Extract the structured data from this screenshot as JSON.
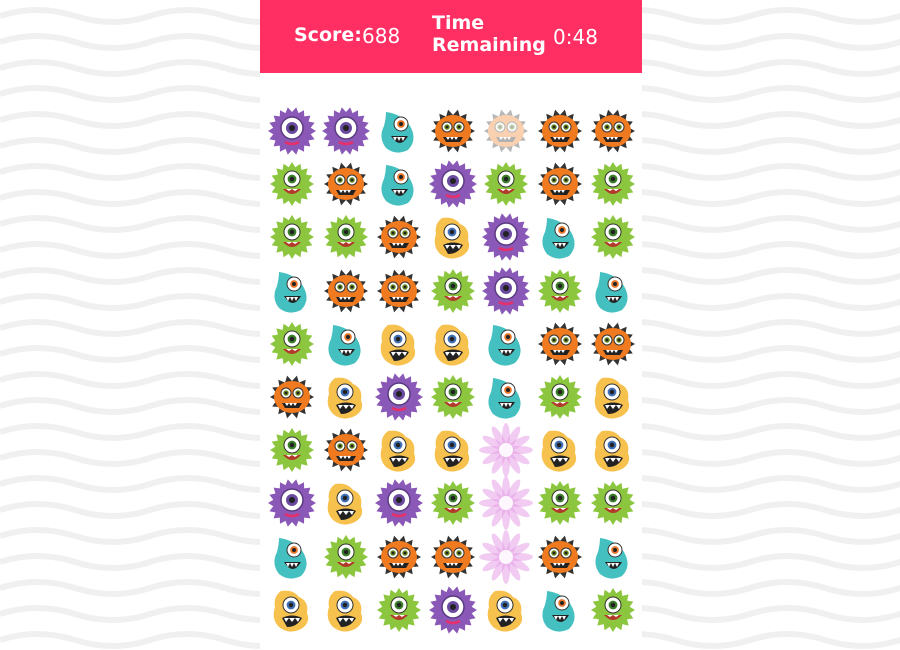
{
  "hud": {
    "score_label": "Score:",
    "score_value": "688",
    "time_label": "Time Remaining",
    "time_value": "0:48"
  },
  "colors": {
    "header": "#ff2e63",
    "purple": "#8a58b6",
    "orange": "#f07a1f",
    "teal": "#45c0c0",
    "green": "#8cc63e",
    "yellow": "#f7c14e",
    "burst": "#e6a0e6"
  },
  "board": {
    "rows": [
      [
        "purple",
        "purple",
        "teal",
        "orange",
        "orange-faded",
        "orange",
        "orange"
      ],
      [
        "green",
        "orange",
        "teal",
        "purple",
        "green",
        "orange",
        "green"
      ],
      [
        "green",
        "green",
        "orange",
        "yellow",
        "purple",
        "teal",
        "green"
      ],
      [
        "teal",
        "orange",
        "orange",
        "green",
        "purple",
        "green",
        "teal"
      ],
      [
        "green",
        "teal",
        "yellow",
        "yellow",
        "teal",
        "orange",
        "orange"
      ],
      [
        "orange",
        "yellow",
        "purple",
        "green",
        "teal",
        "green",
        "yellow"
      ],
      [
        "green",
        "orange",
        "yellow",
        "yellow",
        "burst",
        "yellow",
        "yellow"
      ],
      [
        "purple",
        "yellow",
        "purple",
        "green",
        "burst",
        "green",
        "green"
      ],
      [
        "teal",
        "green",
        "orange",
        "orange",
        "burst",
        "orange",
        "teal"
      ],
      [
        "yellow",
        "yellow",
        "green",
        "purple",
        "yellow",
        "teal",
        "green"
      ]
    ]
  }
}
